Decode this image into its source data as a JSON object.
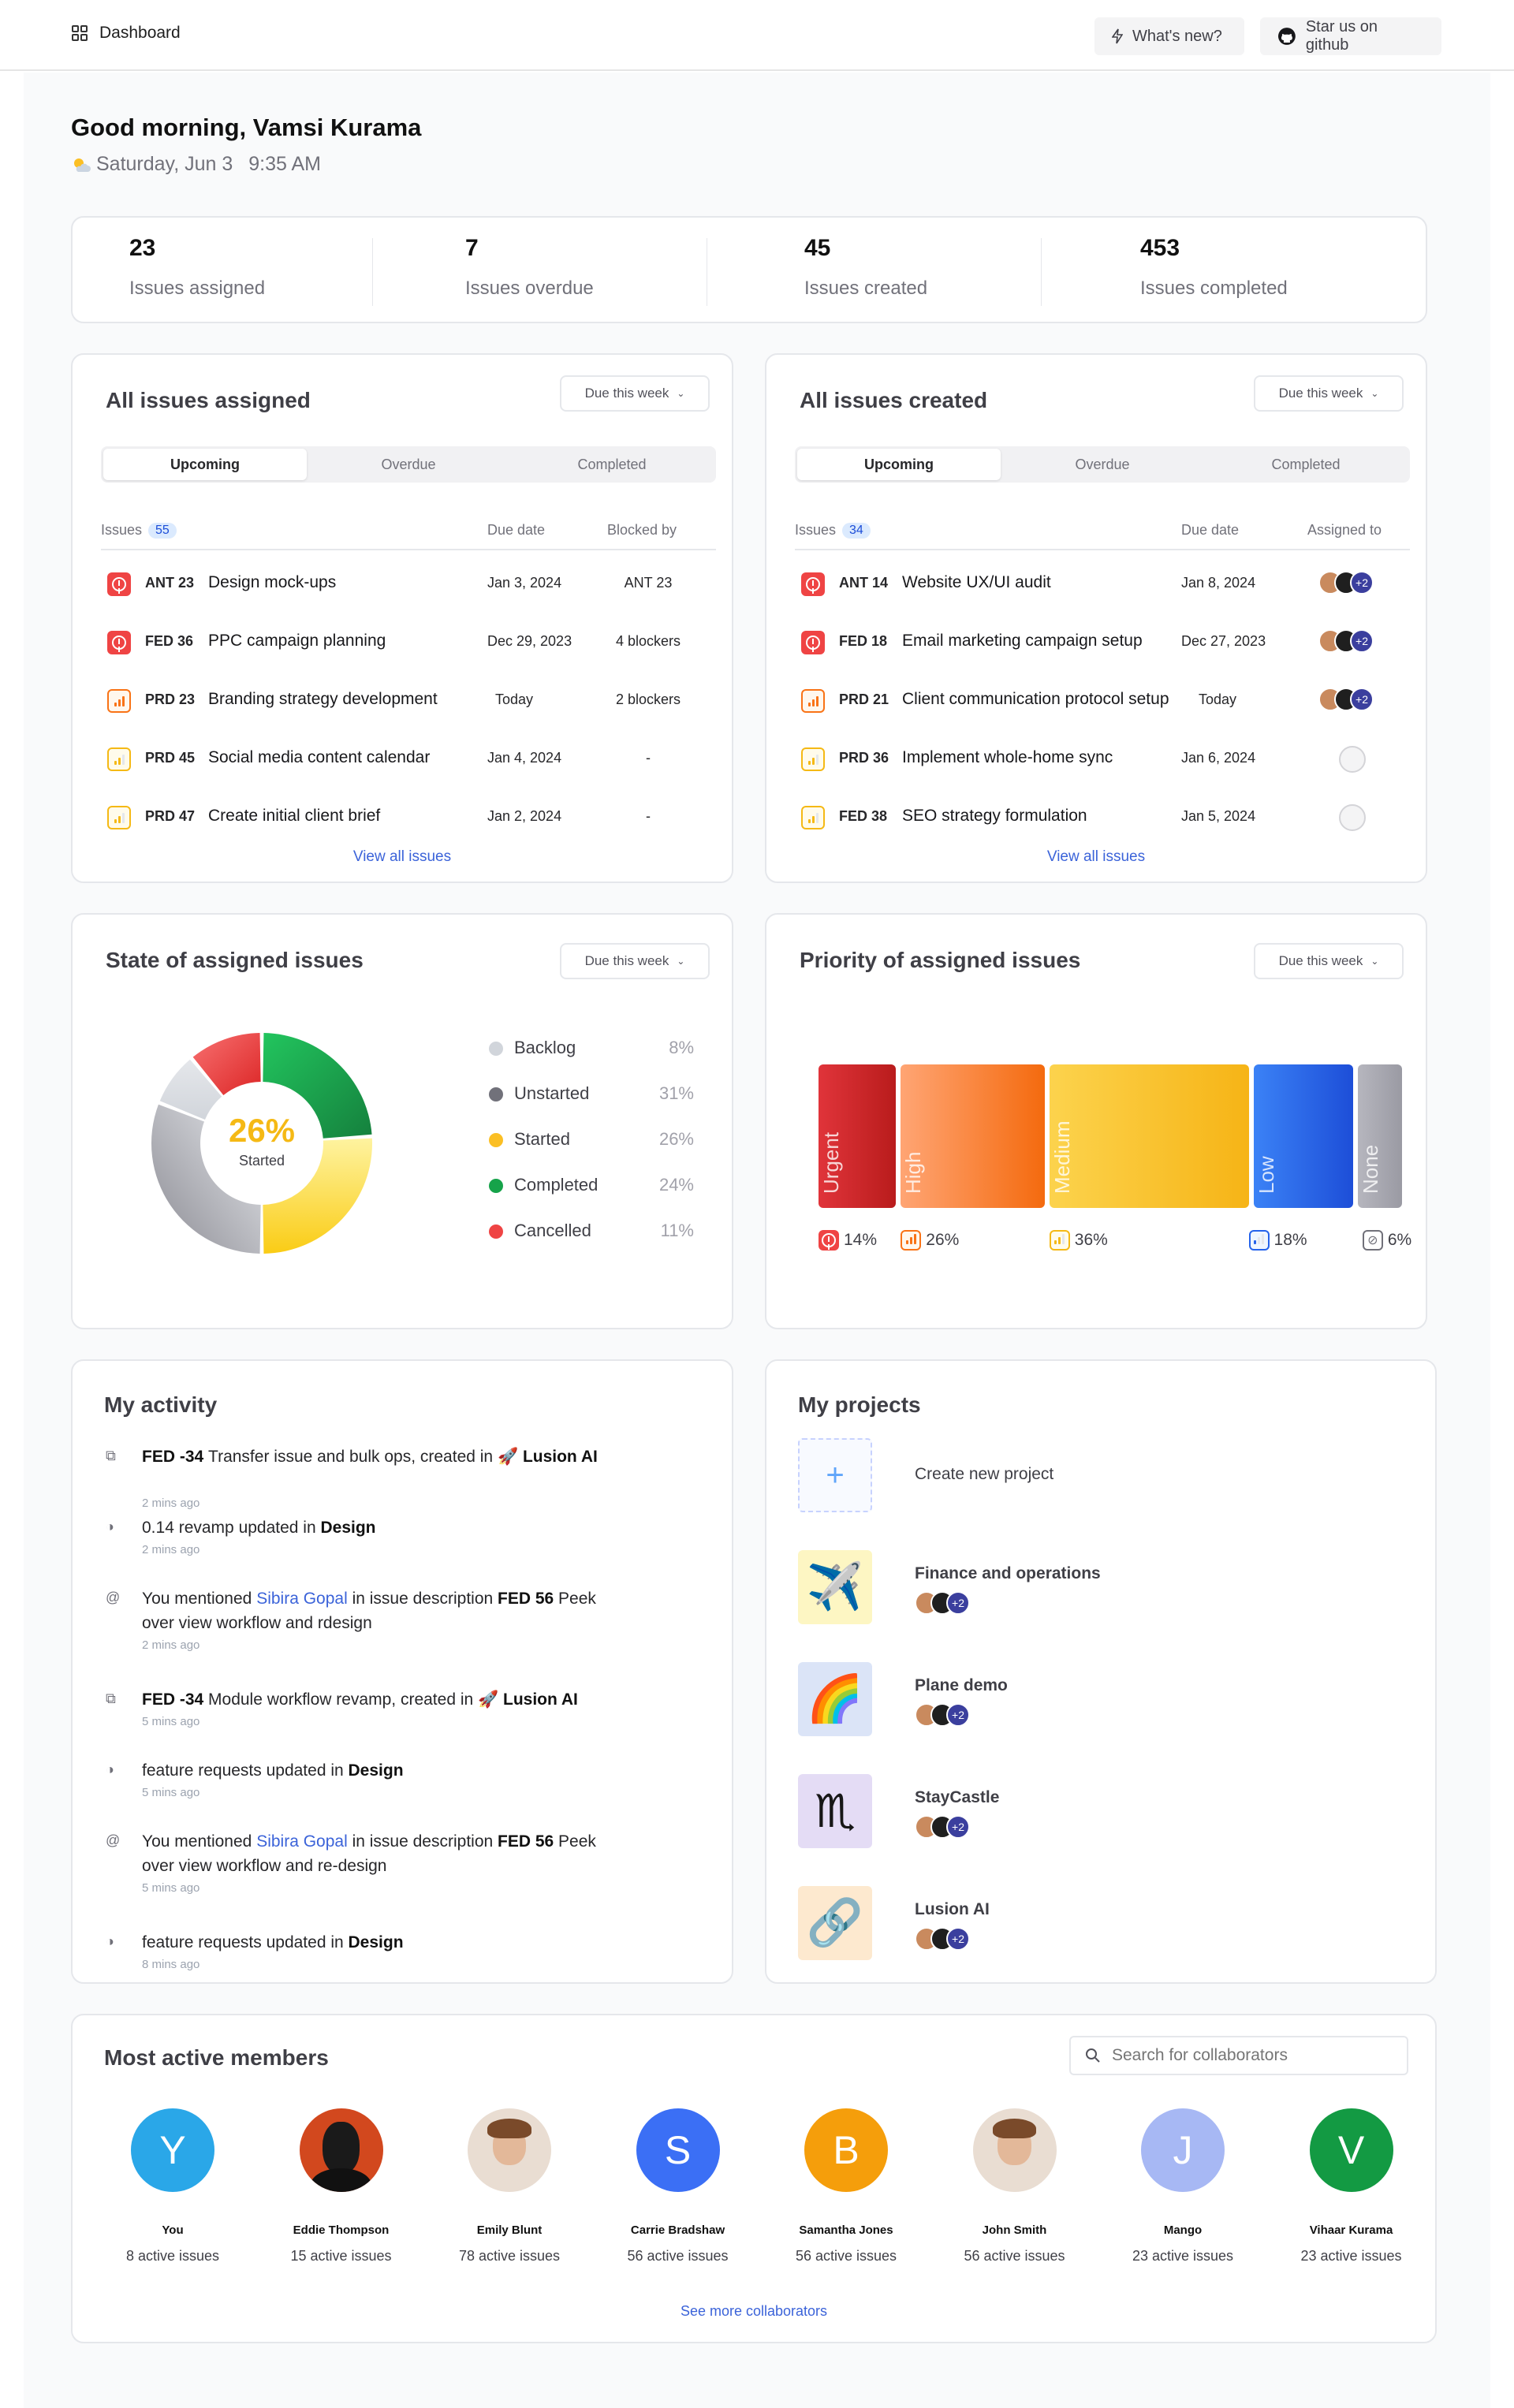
{
  "topbar": {
    "breadcrumb": "Dashboard",
    "whats_new": "What's new?",
    "github": "Star us on github"
  },
  "greeting": {
    "title": "Good morning, Vamsi Kurama",
    "weather_icon": "partly-sunny-icon",
    "date": "Saturday, Jun 3",
    "time": "9:35 AM"
  },
  "stats": [
    {
      "value": "23",
      "label": "Issues assigned"
    },
    {
      "value": "7",
      "label": "Issues overdue"
    },
    {
      "value": "45",
      "label": "Issues created"
    },
    {
      "value": "453",
      "label": "Issues completed"
    }
  ],
  "assigned": {
    "title": "All issues assigned",
    "filter": "Due this week",
    "tabs": [
      "Upcoming",
      "Overdue",
      "Completed"
    ],
    "col_issues": "Issues",
    "count": "55",
    "col_due": "Due date",
    "col_extra": "Blocked by",
    "rows": [
      {
        "priority": "urgent",
        "id": "ANT 23",
        "title": "Design mock-ups",
        "due": "Jan 3, 2024",
        "extra": "ANT 23"
      },
      {
        "priority": "urgent",
        "id": "FED 36",
        "title": "PPC campaign planning",
        "due": "Dec 29, 2023",
        "extra": "4 blockers"
      },
      {
        "priority": "high",
        "id": "PRD 23",
        "title": "Branding strategy development",
        "due": "Today",
        "extra": "2 blockers"
      },
      {
        "priority": "medium",
        "id": "PRD 45",
        "title": "Social media content calendar",
        "due": "Jan 4, 2024",
        "extra": "-"
      },
      {
        "priority": "medium",
        "id": "PRD 47",
        "title": "Create initial client brief",
        "due": "Jan 2, 2024",
        "extra": "-"
      }
    ],
    "view_all": "View all issues"
  },
  "created": {
    "title": "All issues created",
    "filter": "Due this week",
    "tabs": [
      "Upcoming",
      "Overdue",
      "Completed"
    ],
    "col_issues": "Issues",
    "count": "34",
    "col_due": "Due date",
    "col_extra": "Assigned to",
    "rows": [
      {
        "priority": "urgent",
        "id": "ANT 14",
        "title": "Website UX/UI audit",
        "due": "Jan 8, 2024",
        "extra": "+2"
      },
      {
        "priority": "urgent",
        "id": "FED 18",
        "title": "Email marketing campaign setup",
        "due": "Dec 27, 2023",
        "extra": "+2"
      },
      {
        "priority": "high",
        "id": "PRD 21",
        "title": "Client communication protocol setup",
        "due": "Today",
        "extra": "+2"
      },
      {
        "priority": "medium",
        "id": "PRD 36",
        "title": "Implement whole-home sync",
        "due": "Jan 6, 2024",
        "extra": ""
      },
      {
        "priority": "medium",
        "id": "FED 38",
        "title": "SEO strategy formulation",
        "due": "Jan 5, 2024",
        "extra": ""
      }
    ],
    "view_all": "View all issues"
  },
  "state": {
    "title": "State of assigned issues",
    "filter": "Due this week",
    "center_value": "26%",
    "center_label": "Started",
    "items": [
      {
        "name": "Backlog",
        "pct": "8%",
        "color": "#d1d5db"
      },
      {
        "name": "Unstarted",
        "pct": "31%",
        "color": "#71717a"
      },
      {
        "name": "Started",
        "pct": "26%",
        "color": "#fbbf24"
      },
      {
        "name": "Completed",
        "pct": "24%",
        "color": "#16a34a"
      },
      {
        "name": "Cancelled",
        "pct": "11%",
        "color": "#ef4444"
      }
    ]
  },
  "chart_data": [
    {
      "type": "pie",
      "categories": [
        "Backlog",
        "Unstarted",
        "Started",
        "Completed",
        "Cancelled"
      ],
      "values": [
        8,
        31,
        26,
        24,
        11
      ]
    },
    {
      "type": "bar",
      "categories": [
        "Urgent",
        "High",
        "Medium",
        "Low",
        "None"
      ],
      "values": [
        14,
        26,
        36,
        18,
        6
      ]
    }
  ],
  "priority": {
    "title": "Priority of assigned issues",
    "filter": "Due this week",
    "bars": [
      {
        "name": "Urgent",
        "pct": "14%",
        "c1": "#e0343a",
        "c2": "#b91c1c"
      },
      {
        "name": "High",
        "pct": "26%",
        "c1": "#ffa574",
        "c2": "#f46a0e"
      },
      {
        "name": "Medium",
        "pct": "36%",
        "c1": "#fcd34d",
        "c2": "#f6b416"
      },
      {
        "name": "Low",
        "pct": "18%",
        "c1": "#3b82f6",
        "c2": "#1d4ed8"
      },
      {
        "name": "None",
        "pct": "6%",
        "c1": "#b6b6be",
        "c2": "#9a9aa3"
      }
    ]
  },
  "activity": {
    "title": "My activity",
    "items": [
      {
        "icon": "layers-icon",
        "time": "2 mins ago",
        "parts": [
          [
            "b",
            "FED -34 "
          ],
          [
            "t",
            "Transfer issue and bulk ops, created in "
          ],
          [
            "t",
            "🚀 "
          ],
          [
            "b",
            "Lusion AI"
          ]
        ]
      },
      {
        "icon": "half-circle-icon",
        "time": "2 mins ago",
        "parts": [
          [
            "t",
            "0.14 revamp updated in "
          ],
          [
            "b",
            "Design"
          ]
        ]
      },
      {
        "icon": "at-icon",
        "time": "2 mins ago",
        "parts": [
          [
            "t",
            "You mentioned "
          ],
          [
            "l",
            "Sibira Gopal"
          ],
          [
            "t",
            " in issue description "
          ],
          [
            "b",
            "FED 56"
          ],
          [
            "t",
            " Peek over view workflow and rdesign"
          ]
        ]
      },
      {
        "icon": "layers-icon",
        "time": "5 mins ago",
        "parts": [
          [
            "b",
            "FED -34 "
          ],
          [
            "t",
            " Module  workflow revamp, created in "
          ],
          [
            "t",
            "🚀 "
          ],
          [
            "b",
            "Lusion AI"
          ]
        ]
      },
      {
        "icon": "half-circle-icon",
        "time": "5 mins ago",
        "parts": [
          [
            "t",
            "feature requests updated in "
          ],
          [
            "b",
            "Design"
          ]
        ]
      },
      {
        "icon": "at-icon",
        "time": "5 mins ago",
        "parts": [
          [
            "t",
            "You mentioned "
          ],
          [
            "l",
            "Sibira Gopal"
          ],
          [
            "t",
            " in issue description "
          ],
          [
            "b",
            "FED 56"
          ],
          [
            "t",
            " Peek over view workflow and re-design"
          ]
        ]
      },
      {
        "icon": "half-circle-icon",
        "time": "8 mins ago",
        "parts": [
          [
            "t",
            "feature requests updated in "
          ],
          [
            "b",
            "Design"
          ]
        ]
      }
    ]
  },
  "projects": {
    "title": "My projects",
    "create": "Create new project",
    "items": [
      {
        "name": "Finance and operations",
        "emoji": "✈️",
        "bg": "#fdf6c3",
        "extra": "+2"
      },
      {
        "name": "Plane demo",
        "emoji": "🌈",
        "bg": "#dbe4f7",
        "extra": "+2"
      },
      {
        "name": "StayCastle",
        "emoji": "♏",
        "bg": "#e4dcf5",
        "extra": "+2"
      },
      {
        "name": "Lusion AI",
        "emoji": "🔗",
        "bg": "#fde9cf",
        "extra": "+2"
      }
    ]
  },
  "members": {
    "title": "Most active members",
    "search_placeholder": "Search for collaborators",
    "items": [
      {
        "name": "You",
        "initial": "Y",
        "color": "#2aa7e8",
        "issues": "8 active issues"
      },
      {
        "name": "Eddie Thompson",
        "initial": "",
        "color": "dark",
        "issues": "15 active issues"
      },
      {
        "name": "Emily Blunt",
        "initial": "",
        "color": "face",
        "issues": "78 active issues"
      },
      {
        "name": "Carrie Bradshaw",
        "initial": "S",
        "color": "#3b6ff5",
        "issues": "56 active issues"
      },
      {
        "name": "Samantha Jones",
        "initial": "B",
        "color": "#f59e0b",
        "issues": "56 active issues"
      },
      {
        "name": "John Smith",
        "initial": "",
        "color": "face",
        "issues": "56 active issues"
      },
      {
        "name": "Mango",
        "initial": "J",
        "color": "#a7b8f4",
        "issues": "23 active issues"
      },
      {
        "name": "Vihaar Kurama",
        "initial": "V",
        "color": "#139a43",
        "issues": "23 active issues"
      }
    ],
    "see_more": "See more collaborators"
  }
}
